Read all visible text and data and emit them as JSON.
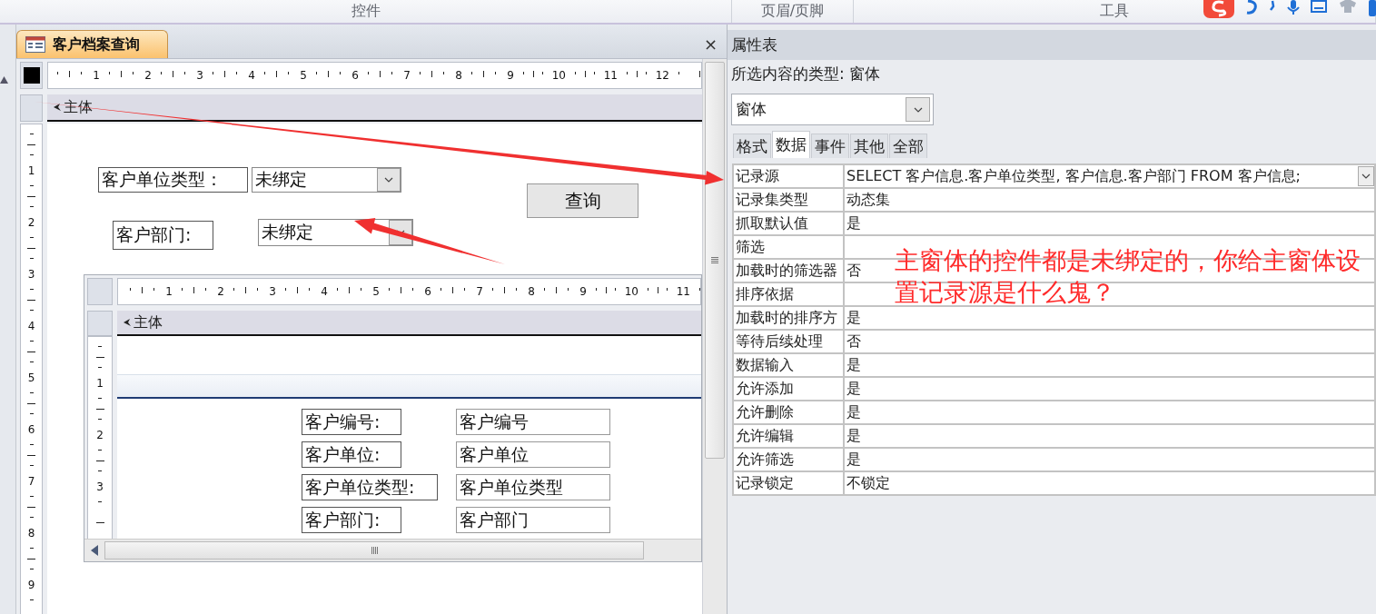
{
  "ribbon_groups": [
    "控件",
    "页眉/页脚",
    "工具"
  ],
  "document_tab": {
    "title": "客户档案查询",
    "close": "×"
  },
  "form": {
    "ruler_h": [
      "1",
      "2",
      "3",
      "4",
      "5",
      "6",
      "7",
      "8",
      "9",
      "10",
      "11",
      "12"
    ],
    "ruler_v": [
      "1",
      "2",
      "3",
      "4",
      "5",
      "6",
      "7",
      "8",
      "9"
    ],
    "section": "主体",
    "controls": [
      {
        "kind": "label",
        "text": "客户单位类型："
      },
      {
        "kind": "combo",
        "value": "未绑定"
      },
      {
        "kind": "button",
        "text": "查询"
      },
      {
        "kind": "label",
        "text": "客户部门:"
      },
      {
        "kind": "combo",
        "value": "未绑定"
      }
    ],
    "subform": {
      "ruler_h": [
        "1",
        "2",
        "3",
        "4",
        "5",
        "6",
        "7",
        "8",
        "9",
        "10",
        "11"
      ],
      "ruler_v": [
        "1",
        "2",
        "3"
      ],
      "section": "主体",
      "fields": [
        {
          "label": "客户编号:",
          "value": "客户编号"
        },
        {
          "label": "客户单位:",
          "value": "客户单位"
        },
        {
          "label": "客户单位类型:",
          "value": "客户单位类型"
        },
        {
          "label": "客户部门:",
          "value": "客户部门"
        }
      ]
    }
  },
  "property_sheet": {
    "title": "属性表",
    "selection_type": "所选内容的类型: 窗体",
    "object": "窗体",
    "tabs": [
      {
        "label": "格式",
        "selected": false
      },
      {
        "label": "数据",
        "selected": true
      },
      {
        "label": "事件",
        "selected": false
      },
      {
        "label": "其他",
        "selected": false
      },
      {
        "label": "全部",
        "selected": false
      }
    ],
    "properties": [
      {
        "kind": "dropdown",
        "name": "记录源",
        "value": "SELECT 客户信息.客户单位类型, 客户信息.客户部门 FROM 客户信息;"
      },
      {
        "kind": "text",
        "name": "记录集类型",
        "value": "动态集"
      },
      {
        "kind": "text",
        "name": "抓取默认值",
        "value": "是"
      },
      {
        "kind": "text",
        "name": "筛选"
      },
      {
        "kind": "text",
        "name": "加载时的筛选器",
        "value": "否"
      },
      {
        "kind": "text",
        "name": "排序依据"
      },
      {
        "kind": "text",
        "name": "加载时的排序方",
        "value": "是"
      },
      {
        "kind": "text",
        "name": "等待后续处理",
        "value": "否"
      },
      {
        "kind": "text",
        "name": "数据输入",
        "value": "是"
      },
      {
        "kind": "text",
        "name": "允许添加",
        "value": "是"
      },
      {
        "kind": "text",
        "name": "允许删除",
        "value": "是"
      },
      {
        "kind": "text",
        "name": "允许编辑",
        "value": "是"
      },
      {
        "kind": "text",
        "name": "允许筛选",
        "value": "是"
      },
      {
        "kind": "text",
        "name": "记录锁定",
        "value": "不锁定"
      }
    ]
  },
  "annotation": {
    "text": "主窗体的控件都是未绑定的，你给主窗体设置记录源是什么鬼？"
  }
}
